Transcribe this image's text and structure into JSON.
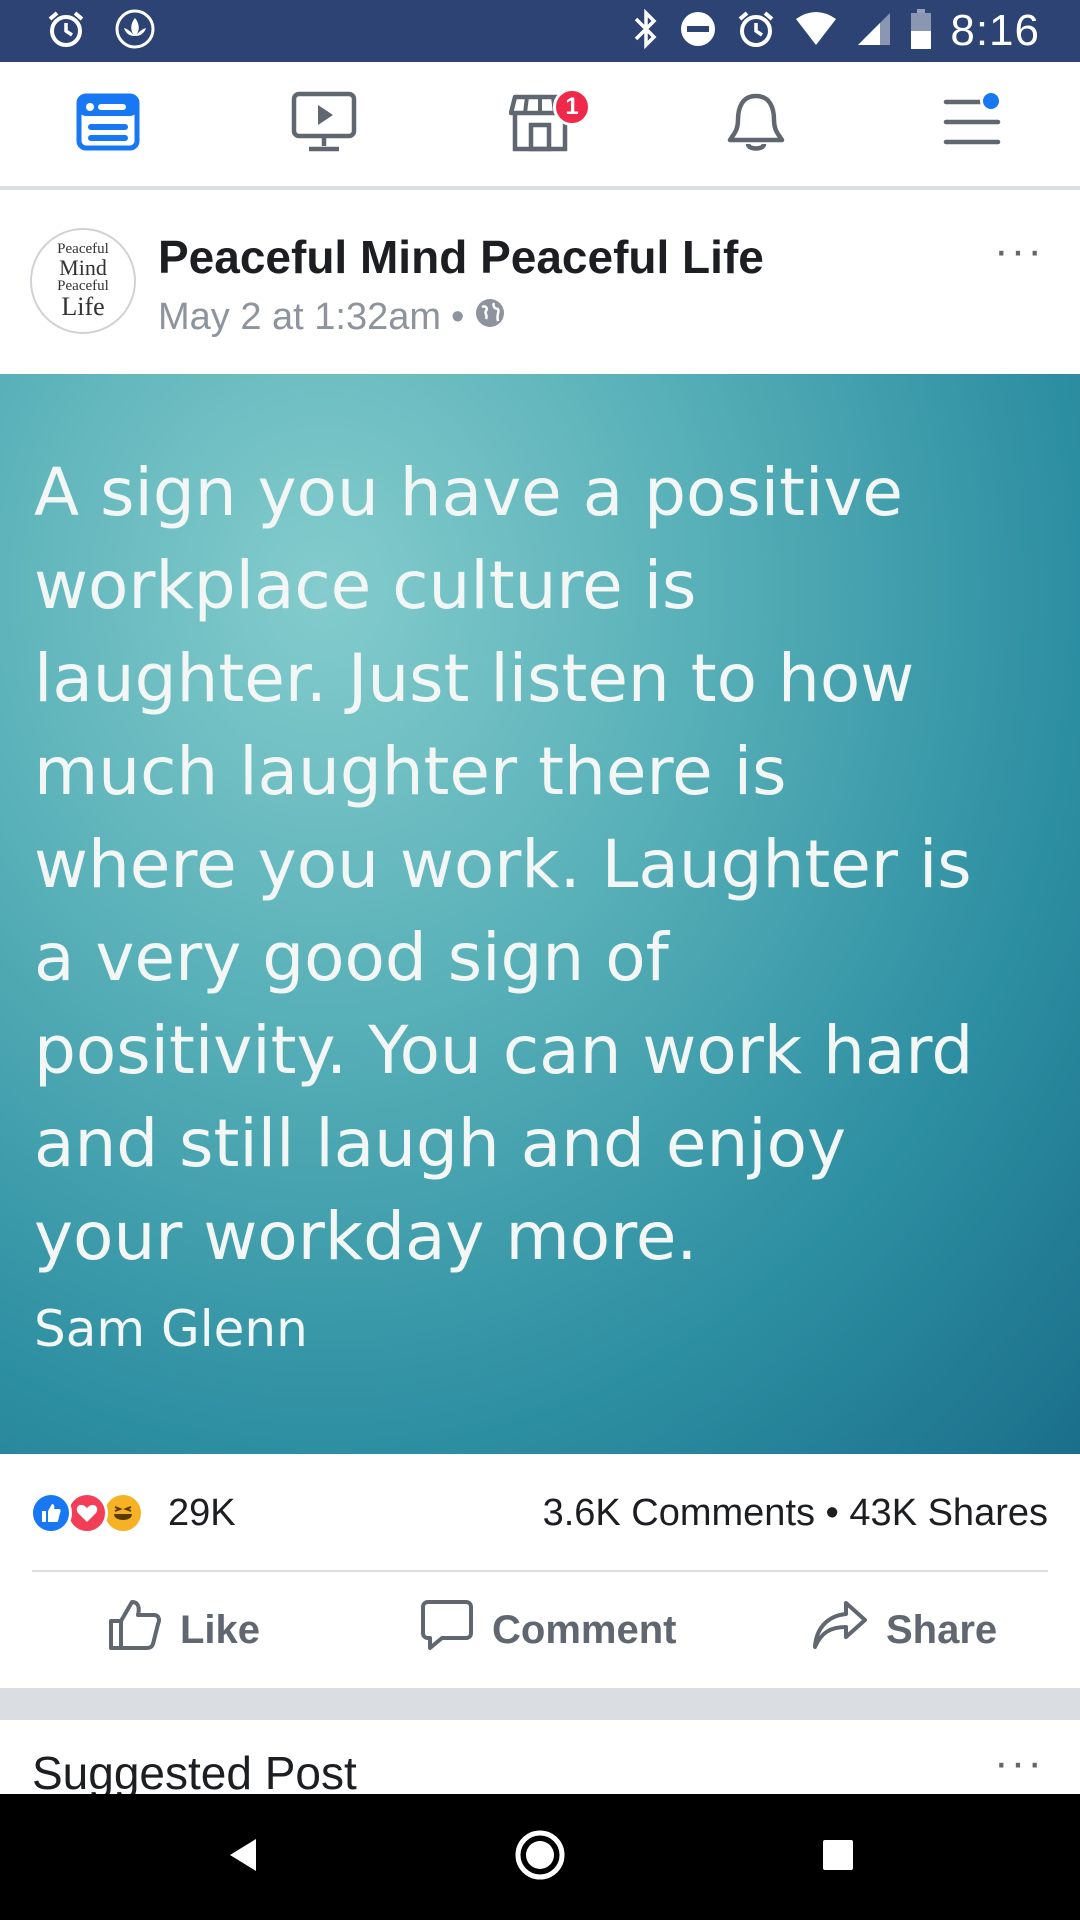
{
  "status_bar": {
    "time": "8:16",
    "left_icons": [
      "alarm-icon",
      "lotus-icon"
    ],
    "right_icons": [
      "bluetooth-icon",
      "do-not-disturb-icon",
      "alarm-icon",
      "wifi-icon",
      "signal-icon",
      "battery-icon"
    ]
  },
  "top_nav": {
    "items": [
      {
        "name": "news-feed",
        "icon": "news-feed-icon",
        "active": true
      },
      {
        "name": "watch",
        "icon": "video-icon"
      },
      {
        "name": "marketplace",
        "icon": "marketplace-icon",
        "badge": "1"
      },
      {
        "name": "notifications",
        "icon": "bell-icon"
      },
      {
        "name": "menu",
        "icon": "menu-icon",
        "dot": true
      }
    ],
    "active_color": "#1877f2"
  },
  "post": {
    "page_name": "Peaceful Mind Peaceful Life",
    "timestamp": "May 2 at 1:32am",
    "meta_separator": "•",
    "privacy_icon": "globe-icon",
    "more_label": "···",
    "avatar_lines": [
      "Peaceful",
      "Mind",
      "Peaceful",
      "Life"
    ],
    "image": {
      "quote": "A sign you have a positive\nworkplace culture is\nlaughter.  Just listen to how\nmuch laughter there is\nwhere you work.  Laughter is\na very good sign of\npositivity.  You can work hard\nand still laugh and enjoy\nyour workday more.",
      "author": "Sam Glenn"
    },
    "reactions": {
      "types": [
        "like",
        "love",
        "haha"
      ],
      "count": "29K",
      "comments_shares": "3.6K Comments • 43K Shares"
    },
    "actions": {
      "like_label": "Like",
      "comment_label": "Comment",
      "share_label": "Share"
    }
  },
  "suggested": {
    "title": "Suggested Post",
    "more_label": "···"
  },
  "android_nav": [
    "back-icon",
    "home-icon",
    "recents-icon"
  ]
}
